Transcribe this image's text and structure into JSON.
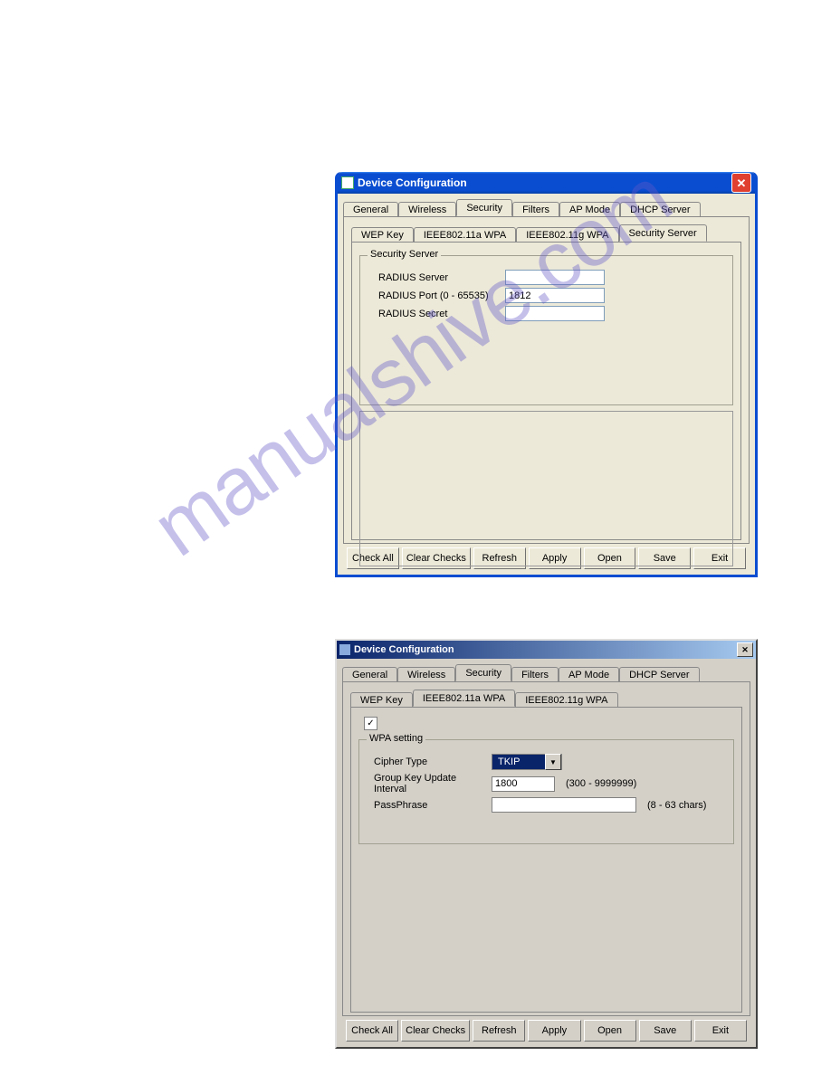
{
  "watermark": "manualshive.com",
  "win1": {
    "title": "Device Configuration",
    "tabs_top": [
      "General",
      "Wireless",
      "Security",
      "Filters",
      "AP Mode",
      "DHCP Server"
    ],
    "tabs_top_active": 2,
    "tabs_sub": [
      "WEP Key",
      "IEEE802.11a WPA",
      "IEEE802.11g WPA",
      "Security Server"
    ],
    "tabs_sub_active": 3,
    "group_title": "Security Server",
    "fields": {
      "radius_server_label": "RADIUS Server",
      "radius_server_value": "",
      "radius_port_label": "RADIUS Port  (0 - 65535)",
      "radius_port_value": "1812",
      "radius_secret_label": "RADIUS Secret",
      "radius_secret_value": ""
    },
    "buttons": [
      "Check All",
      "Clear Checks",
      "Refresh",
      "Apply",
      "Open",
      "Save",
      "Exit"
    ]
  },
  "win2": {
    "title": "Device Configuration",
    "tabs_top": [
      "General",
      "Wireless",
      "Security",
      "Filters",
      "AP Mode",
      "DHCP Server"
    ],
    "tabs_top_active": 2,
    "tabs_sub": [
      "WEP Key",
      "IEEE802.11a WPA",
      "IEEE802.11g WPA"
    ],
    "tabs_sub_active": 1,
    "checkbox_checked": true,
    "group_title": "WPA setting",
    "fields": {
      "cipher_label": "Cipher Type",
      "cipher_value": "TKIP",
      "gkui_label": "Group Key Update Interval",
      "gkui_value": "1800",
      "gkui_hint": "(300 - 9999999)",
      "pass_label": "PassPhrase",
      "pass_value": "",
      "pass_hint": "(8 - 63 chars)"
    },
    "buttons": [
      "Check All",
      "Clear Checks",
      "Refresh",
      "Apply",
      "Open",
      "Save",
      "Exit"
    ]
  }
}
